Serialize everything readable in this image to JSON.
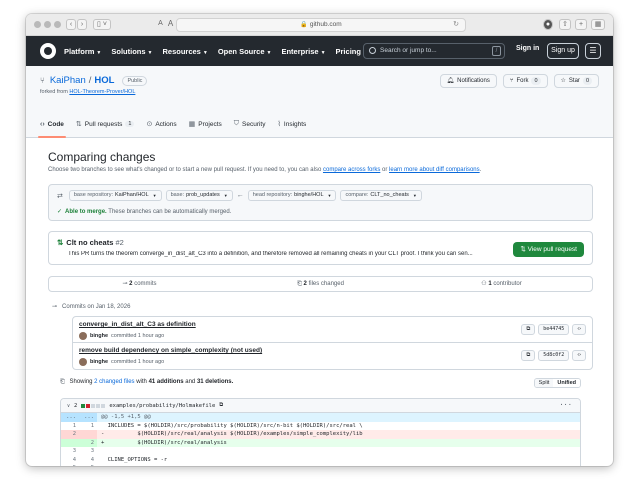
{
  "browser": {
    "url": "github.com",
    "text_size_small": "A",
    "text_size_large": "A"
  },
  "header": {
    "nav": [
      "Platform",
      "Solutions",
      "Resources",
      "Open Source",
      "Enterprise",
      "Pricing"
    ],
    "search_placeholder": "Search or jump to...",
    "search_shortcut": "/",
    "signin": "Sign in",
    "signup": "Sign up"
  },
  "repo": {
    "owner": "KaiPhan",
    "name": "HOL",
    "visibility": "Public",
    "forked_prefix": "forked from",
    "forked_from": "HOL-Theorem-Prover/HOL",
    "notifications": "Notifications",
    "fork_label": "Fork",
    "fork_count": "0",
    "star_label": "Star",
    "star_count": "0",
    "tabs": [
      {
        "label": "Code",
        "icon": "code-icon"
      },
      {
        "label": "Pull requests",
        "count": "1",
        "icon": "pull-request-icon"
      },
      {
        "label": "Actions",
        "icon": "play-icon"
      },
      {
        "label": "Projects",
        "icon": "table-icon"
      },
      {
        "label": "Security",
        "icon": "shield-icon"
      },
      {
        "label": "Insights",
        "icon": "graph-icon"
      }
    ]
  },
  "compare": {
    "title": "Comparing changes",
    "subtitle_pre": "Choose two branches to see what's changed or to start a new pull request. If you need to, you can also",
    "subtitle_link1": "compare across forks",
    "subtitle_or": "or",
    "subtitle_link2": "learn more about diff comparisons",
    "base_repo_label": "base repository:",
    "base_repo": "KaiPhan/HOL",
    "base_label": "base:",
    "base": "prob_updates",
    "head_repo_label": "head repository:",
    "head_repo": "binghe/HOL",
    "compare_label": "compare:",
    "compare": "CLT_no_cheats",
    "merge_status": "Able to merge.",
    "merge_note": "These branches can be automatically merged."
  },
  "pr": {
    "title": "Clt no cheats",
    "number": "#2",
    "description": "This PR turns the theorem converge_in_dist_alt_C3 into a definition, and therefore removed all remaining cheats in your CLT proof. I think you can sen...",
    "button": "View pull request"
  },
  "stats": {
    "commits_count": "2",
    "commits_label": "commits",
    "files_count": "2",
    "files_label": "files changed",
    "contributors_count": "1",
    "contributors_label": "contributor"
  },
  "commits": {
    "date_header": "Commits on Jan 18, 2026",
    "items": [
      {
        "message": "converge_in_dist_alt_C3 as definition",
        "author": "binghe",
        "time": "committed 1 hour ago",
        "sha": "be44745"
      },
      {
        "message": "remove build dependency on simple_complexity (not used)",
        "author": "binghe",
        "time": "committed 1 hour ago",
        "sha": "5d8c0f2"
      }
    ]
  },
  "files": {
    "showing_pre": "Showing",
    "changed_files": "2 changed files",
    "with": "with",
    "additions": "41 additions",
    "and": "and",
    "deletions": "31 deletions.",
    "split": "Split",
    "unified": "Unified"
  },
  "diff": {
    "count": "2",
    "path": "examples/probability/Holmakefile",
    "hunk_left": "...",
    "hunk_right": "...",
    "hunk": "@@ -1,5 +1,5 @@",
    "lines": [
      {
        "type": "ctx",
        "old": "1",
        "new": "1",
        "text": "  INCLUDES = $(HOLDIR)/src/probability $(HOLDIR)/src/n-bit $(HOLDIR)/src/real \\"
      },
      {
        "type": "del",
        "old": "2",
        "new": "",
        "text": "-          $(HOLDIR)/src/real/analysis $(HOLDIR)/examples/simple_complexity/lib"
      },
      {
        "type": "add",
        "old": "",
        "new": "2",
        "text": "+          $(HOLDIR)/src/real/analysis"
      },
      {
        "type": "ctx",
        "old": "3",
        "new": "3",
        "text": ""
      },
      {
        "type": "ctx",
        "old": "4",
        "new": "4",
        "text": "  CLINE_OPTIONS = -r"
      },
      {
        "type": "ctx",
        "old": "5",
        "new": "5",
        "text": ""
      }
    ]
  },
  "colors": {
    "header_bg": "#24292f",
    "link": "#0969da",
    "success": "#1a7f37",
    "button_green": "#1f883d",
    "tab_underline": "#fd8c73"
  }
}
